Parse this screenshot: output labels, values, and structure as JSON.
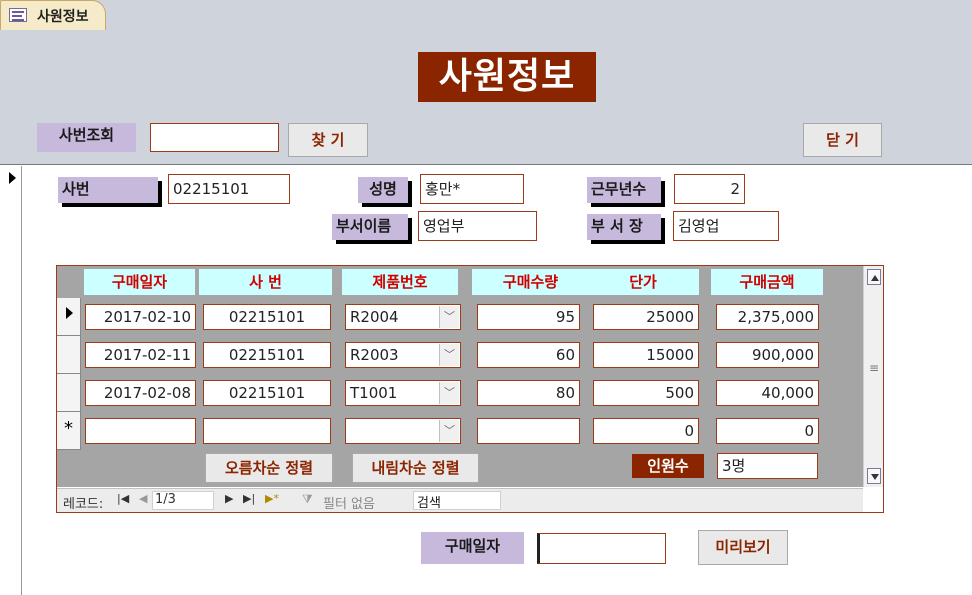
{
  "tab": {
    "title": "사원정보"
  },
  "header": {
    "title": "사원정보",
    "lookup_label": "사번조회",
    "lookup_value": "",
    "find_button": "찾 기",
    "close_button": "닫 기"
  },
  "employee": {
    "id_label": "사번",
    "id_value": "02215101",
    "name_label": "성명",
    "name_value": "홍만*",
    "years_label": "근무년수",
    "years_value": "2",
    "dept_label": "부서이름",
    "dept_value": "영업부",
    "manager_label": "부 서 장",
    "manager_value": "김영업"
  },
  "subform": {
    "columns": [
      "구매일자",
      "사   번",
      "제품번호",
      "구매수량",
      "단가",
      "구매금액"
    ],
    "rows": [
      [
        "2017-02-10",
        "02215101",
        "R2004",
        "95",
        "25000",
        "2,375,000"
      ],
      [
        "2017-02-11",
        "02215101",
        "R2003",
        "60",
        "15000",
        "900,000"
      ],
      [
        "2017-02-08",
        "02215101",
        "T1001",
        "80",
        "500",
        "40,000"
      ]
    ],
    "new_row": [
      "",
      "",
      "",
      "",
      "0",
      "0"
    ],
    "new_row_marker": "*",
    "sort_asc_button": "오름차순 정렬",
    "sort_desc_button": "내림차순 정렬",
    "count_label": "인원수",
    "count_value": "3명",
    "nav": {
      "record_label": "레코드:",
      "record_value": "1/3",
      "filter_label": "필터 없음",
      "search_label": "검색"
    }
  },
  "footer": {
    "date_label": "구매일자",
    "date_value": "",
    "preview_button": "미리보기"
  }
}
